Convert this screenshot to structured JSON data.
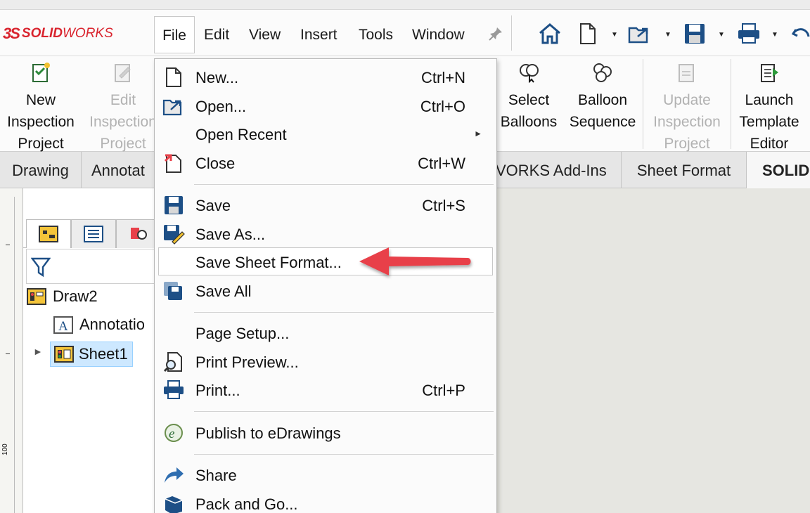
{
  "app": {
    "logo_prefix": "3S",
    "logo_solid": "SOLID",
    "logo_works": "WORKS"
  },
  "menubar": {
    "items": [
      "File",
      "Edit",
      "View",
      "Insert",
      "Tools",
      "Window"
    ],
    "active": "File"
  },
  "command_manager": {
    "buttons": [
      {
        "label": "New\nInspection\nProject",
        "enabled": true,
        "icon": "new-inspection-icon"
      },
      {
        "label": "Edit\nInspection\nProject",
        "enabled": false,
        "icon": "edit-inspection-icon"
      },
      {
        "label": "Select\nBalloons",
        "enabled": true,
        "icon": "select-balloons-icon"
      },
      {
        "label": "Balloon\nSequence",
        "enabled": true,
        "icon": "balloon-sequence-icon"
      },
      {
        "label": "Update\nInspection\nProject",
        "enabled": false,
        "icon": "update-inspection-icon"
      },
      {
        "label": "Launch\nTemplate\nEditor",
        "enabled": true,
        "icon": "launch-template-icon"
      }
    ]
  },
  "tabs": [
    "Drawing",
    "Annotat",
    "VORKS Add-Ins",
    "Sheet Format",
    "SOLID"
  ],
  "feature_tree": {
    "root": "Draw2",
    "children": [
      "Annotatio",
      "Sheet1"
    ],
    "selected": "Sheet1"
  },
  "ruler": {
    "label": "100"
  },
  "file_menu": {
    "items": [
      {
        "label": "New...",
        "shortcut": "Ctrl+N",
        "icon": "new-document-icon"
      },
      {
        "label": "Open...",
        "shortcut": "Ctrl+O",
        "icon": "open-folder-icon"
      },
      {
        "label": "Open Recent",
        "shortcut": "",
        "submenu": true
      },
      {
        "label": "Close",
        "shortcut": "Ctrl+W",
        "icon": "close-document-icon"
      },
      {
        "label": "Save",
        "shortcut": "Ctrl+S",
        "icon": "save-icon"
      },
      {
        "label": "Save As...",
        "shortcut": "",
        "icon": "save-as-icon"
      },
      {
        "label": "Save Sheet Format...",
        "shortcut": "",
        "highlighted": true
      },
      {
        "label": "Save All",
        "shortcut": "",
        "icon": "save-all-icon"
      },
      {
        "label": "Page Setup...",
        "shortcut": ""
      },
      {
        "label": "Print Preview...",
        "shortcut": "",
        "icon": "print-preview-icon"
      },
      {
        "label": "Print...",
        "shortcut": "Ctrl+P",
        "icon": "print-icon"
      },
      {
        "label": "Publish to eDrawings",
        "shortcut": "",
        "icon": "edrawings-icon"
      },
      {
        "label": "Share",
        "shortcut": "",
        "icon": "share-icon"
      },
      {
        "label": "Pack and Go...",
        "shortcut": "",
        "icon": "pack-and-go-icon"
      }
    ]
  },
  "colors": {
    "accent_red": "#e8414a",
    "logo_red": "#d9242e",
    "selection": "#cde8ff"
  }
}
